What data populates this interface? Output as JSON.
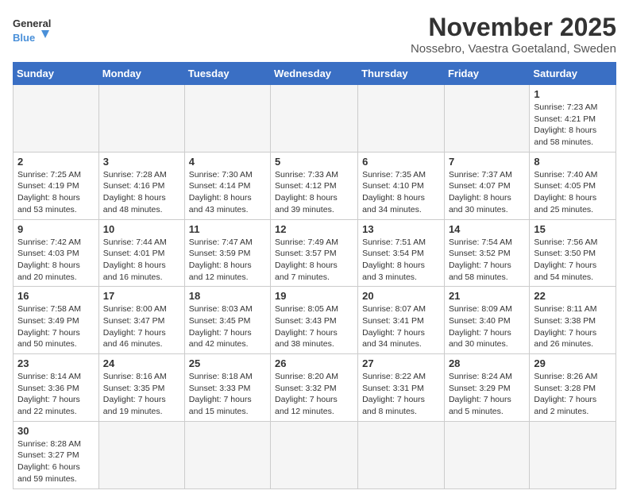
{
  "logo": {
    "text_general": "General",
    "text_blue": "Blue"
  },
  "title": {
    "month_year": "November 2025",
    "location": "Nossebro, Vaestra Goetaland, Sweden"
  },
  "weekdays": [
    "Sunday",
    "Monday",
    "Tuesday",
    "Wednesday",
    "Thursday",
    "Friday",
    "Saturday"
  ],
  "weeks": [
    [
      {
        "day": "",
        "info": ""
      },
      {
        "day": "",
        "info": ""
      },
      {
        "day": "",
        "info": ""
      },
      {
        "day": "",
        "info": ""
      },
      {
        "day": "",
        "info": ""
      },
      {
        "day": "",
        "info": ""
      },
      {
        "day": "1",
        "info": "Sunrise: 7:23 AM\nSunset: 4:21 PM\nDaylight: 8 hours and 58 minutes."
      }
    ],
    [
      {
        "day": "2",
        "info": "Sunrise: 7:25 AM\nSunset: 4:19 PM\nDaylight: 8 hours and 53 minutes."
      },
      {
        "day": "3",
        "info": "Sunrise: 7:28 AM\nSunset: 4:16 PM\nDaylight: 8 hours and 48 minutes."
      },
      {
        "day": "4",
        "info": "Sunrise: 7:30 AM\nSunset: 4:14 PM\nDaylight: 8 hours and 43 minutes."
      },
      {
        "day": "5",
        "info": "Sunrise: 7:33 AM\nSunset: 4:12 PM\nDaylight: 8 hours and 39 minutes."
      },
      {
        "day": "6",
        "info": "Sunrise: 7:35 AM\nSunset: 4:10 PM\nDaylight: 8 hours and 34 minutes."
      },
      {
        "day": "7",
        "info": "Sunrise: 7:37 AM\nSunset: 4:07 PM\nDaylight: 8 hours and 30 minutes."
      },
      {
        "day": "8",
        "info": "Sunrise: 7:40 AM\nSunset: 4:05 PM\nDaylight: 8 hours and 25 minutes."
      }
    ],
    [
      {
        "day": "9",
        "info": "Sunrise: 7:42 AM\nSunset: 4:03 PM\nDaylight: 8 hours and 20 minutes."
      },
      {
        "day": "10",
        "info": "Sunrise: 7:44 AM\nSunset: 4:01 PM\nDaylight: 8 hours and 16 minutes."
      },
      {
        "day": "11",
        "info": "Sunrise: 7:47 AM\nSunset: 3:59 PM\nDaylight: 8 hours and 12 minutes."
      },
      {
        "day": "12",
        "info": "Sunrise: 7:49 AM\nSunset: 3:57 PM\nDaylight: 8 hours and 7 minutes."
      },
      {
        "day": "13",
        "info": "Sunrise: 7:51 AM\nSunset: 3:54 PM\nDaylight: 8 hours and 3 minutes."
      },
      {
        "day": "14",
        "info": "Sunrise: 7:54 AM\nSunset: 3:52 PM\nDaylight: 7 hours and 58 minutes."
      },
      {
        "day": "15",
        "info": "Sunrise: 7:56 AM\nSunset: 3:50 PM\nDaylight: 7 hours and 54 minutes."
      }
    ],
    [
      {
        "day": "16",
        "info": "Sunrise: 7:58 AM\nSunset: 3:49 PM\nDaylight: 7 hours and 50 minutes."
      },
      {
        "day": "17",
        "info": "Sunrise: 8:00 AM\nSunset: 3:47 PM\nDaylight: 7 hours and 46 minutes."
      },
      {
        "day": "18",
        "info": "Sunrise: 8:03 AM\nSunset: 3:45 PM\nDaylight: 7 hours and 42 minutes."
      },
      {
        "day": "19",
        "info": "Sunrise: 8:05 AM\nSunset: 3:43 PM\nDaylight: 7 hours and 38 minutes."
      },
      {
        "day": "20",
        "info": "Sunrise: 8:07 AM\nSunset: 3:41 PM\nDaylight: 7 hours and 34 minutes."
      },
      {
        "day": "21",
        "info": "Sunrise: 8:09 AM\nSunset: 3:40 PM\nDaylight: 7 hours and 30 minutes."
      },
      {
        "day": "22",
        "info": "Sunrise: 8:11 AM\nSunset: 3:38 PM\nDaylight: 7 hours and 26 minutes."
      }
    ],
    [
      {
        "day": "23",
        "info": "Sunrise: 8:14 AM\nSunset: 3:36 PM\nDaylight: 7 hours and 22 minutes."
      },
      {
        "day": "24",
        "info": "Sunrise: 8:16 AM\nSunset: 3:35 PM\nDaylight: 7 hours and 19 minutes."
      },
      {
        "day": "25",
        "info": "Sunrise: 8:18 AM\nSunset: 3:33 PM\nDaylight: 7 hours and 15 minutes."
      },
      {
        "day": "26",
        "info": "Sunrise: 8:20 AM\nSunset: 3:32 PM\nDaylight: 7 hours and 12 minutes."
      },
      {
        "day": "27",
        "info": "Sunrise: 8:22 AM\nSunset: 3:31 PM\nDaylight: 7 hours and 8 minutes."
      },
      {
        "day": "28",
        "info": "Sunrise: 8:24 AM\nSunset: 3:29 PM\nDaylight: 7 hours and 5 minutes."
      },
      {
        "day": "29",
        "info": "Sunrise: 8:26 AM\nSunset: 3:28 PM\nDaylight: 7 hours and 2 minutes."
      }
    ],
    [
      {
        "day": "30",
        "info": "Sunrise: 8:28 AM\nSunset: 3:27 PM\nDaylight: 6 hours and 59 minutes."
      },
      {
        "day": "",
        "info": ""
      },
      {
        "day": "",
        "info": ""
      },
      {
        "day": "",
        "info": ""
      },
      {
        "day": "",
        "info": ""
      },
      {
        "day": "",
        "info": ""
      },
      {
        "day": "",
        "info": ""
      }
    ]
  ]
}
